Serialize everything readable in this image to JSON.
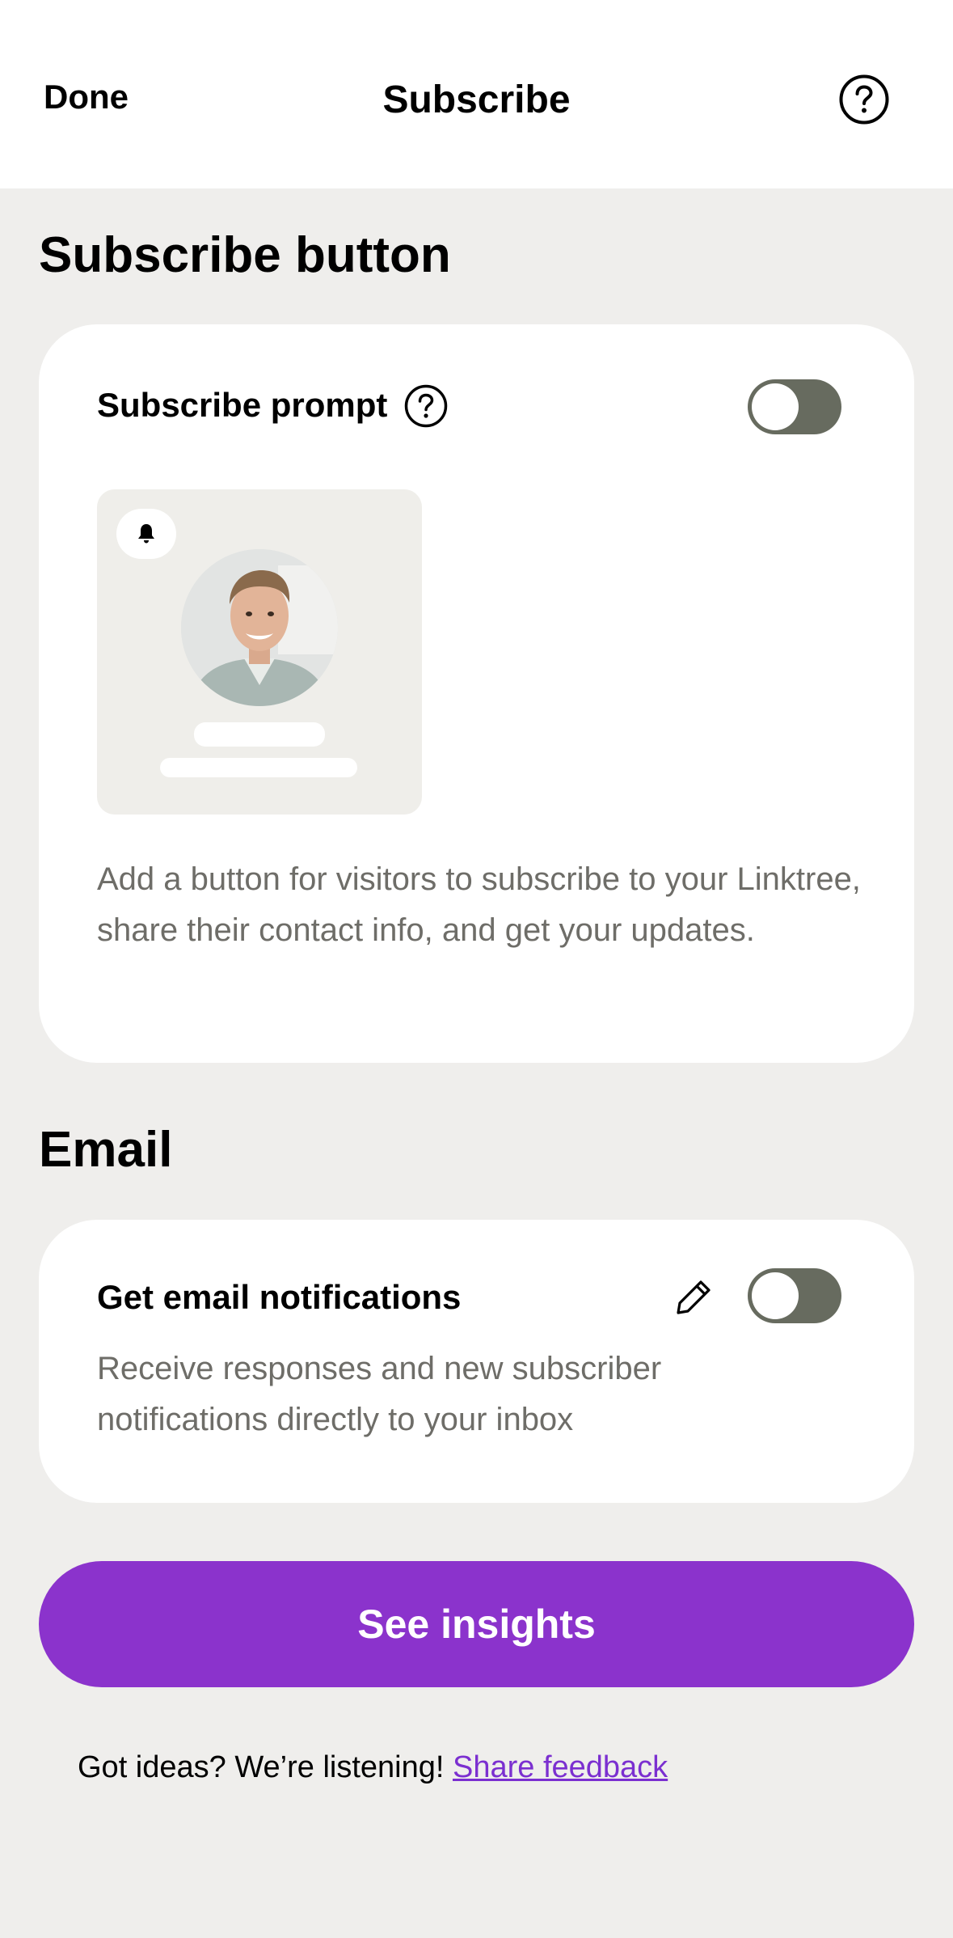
{
  "header": {
    "done_label": "Done",
    "title": "Subscribe",
    "help_icon": "help-circle-icon"
  },
  "subscribe_section": {
    "heading": "Subscribe button",
    "prompt_label": "Subscribe prompt",
    "prompt_help_icon": "help-circle-icon",
    "prompt_toggle_on": false,
    "preview_icon": "bell-icon",
    "description": "Add a button for visitors to subscribe to your Linktree, share their contact info, and get your updates."
  },
  "email_section": {
    "heading": "Email",
    "notifications_label": "Get email notifications",
    "edit_icon": "pencil-icon",
    "notifications_toggle_on": false,
    "description": "Receive responses and new subscriber notifications directly to your inbox"
  },
  "actions": {
    "insights_label": "See insights"
  },
  "footer": {
    "prompt_text": "Got ideas? We’re listening!",
    "link_text": "Share feedback"
  },
  "colors": {
    "accent": "#8b33cc",
    "toggle_off": "#676b5f",
    "background": "#efeeec"
  }
}
